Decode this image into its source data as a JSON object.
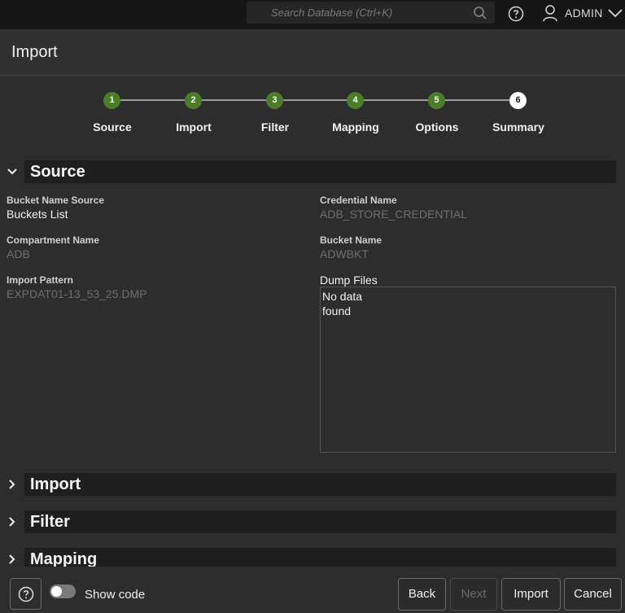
{
  "topbar": {
    "search_placeholder": "Search Database (Ctrl+K)",
    "user_name": "ADMIN"
  },
  "page": {
    "title": "Import"
  },
  "stepper": {
    "steps": [
      {
        "number": "1",
        "label": "Source",
        "state": "done"
      },
      {
        "number": "2",
        "label": "Import",
        "state": "done"
      },
      {
        "number": "3",
        "label": "Filter",
        "state": "done"
      },
      {
        "number": "4",
        "label": "Mapping",
        "state": "done"
      },
      {
        "number": "5",
        "label": "Options",
        "state": "done"
      },
      {
        "number": "6",
        "label": "Summary",
        "state": "current"
      }
    ],
    "done_color": "#4a7d2a",
    "current_color": "#ffffff"
  },
  "sections": {
    "source": {
      "title": "Source",
      "expanded": true,
      "fields": {
        "bucket_name_source": {
          "label": "Bucket Name Source",
          "value": "Buckets List"
        },
        "credential_name": {
          "label": "Credential Name",
          "value": "ADB_STORE_CREDENTIAL"
        },
        "compartment_name": {
          "label": "Compartment Name",
          "value": "ADB"
        },
        "bucket_name": {
          "label": "Bucket Name",
          "value": "ADWBKT"
        },
        "import_pattern": {
          "label": "Import Pattern",
          "value": "EXPDAT01-13_53_25.DMP"
        },
        "dump_files": {
          "label": "Dump Files",
          "value": "No data found"
        }
      }
    },
    "import": {
      "title": "Import",
      "expanded": false
    },
    "filter": {
      "title": "Filter",
      "expanded": false
    },
    "mapping": {
      "title": "Mapping",
      "expanded": false
    }
  },
  "footer": {
    "show_code_label": "Show code",
    "show_code_on": false,
    "back_label": "Back",
    "next_label": "Next",
    "import_label": "Import",
    "cancel_label": "Cancel"
  }
}
